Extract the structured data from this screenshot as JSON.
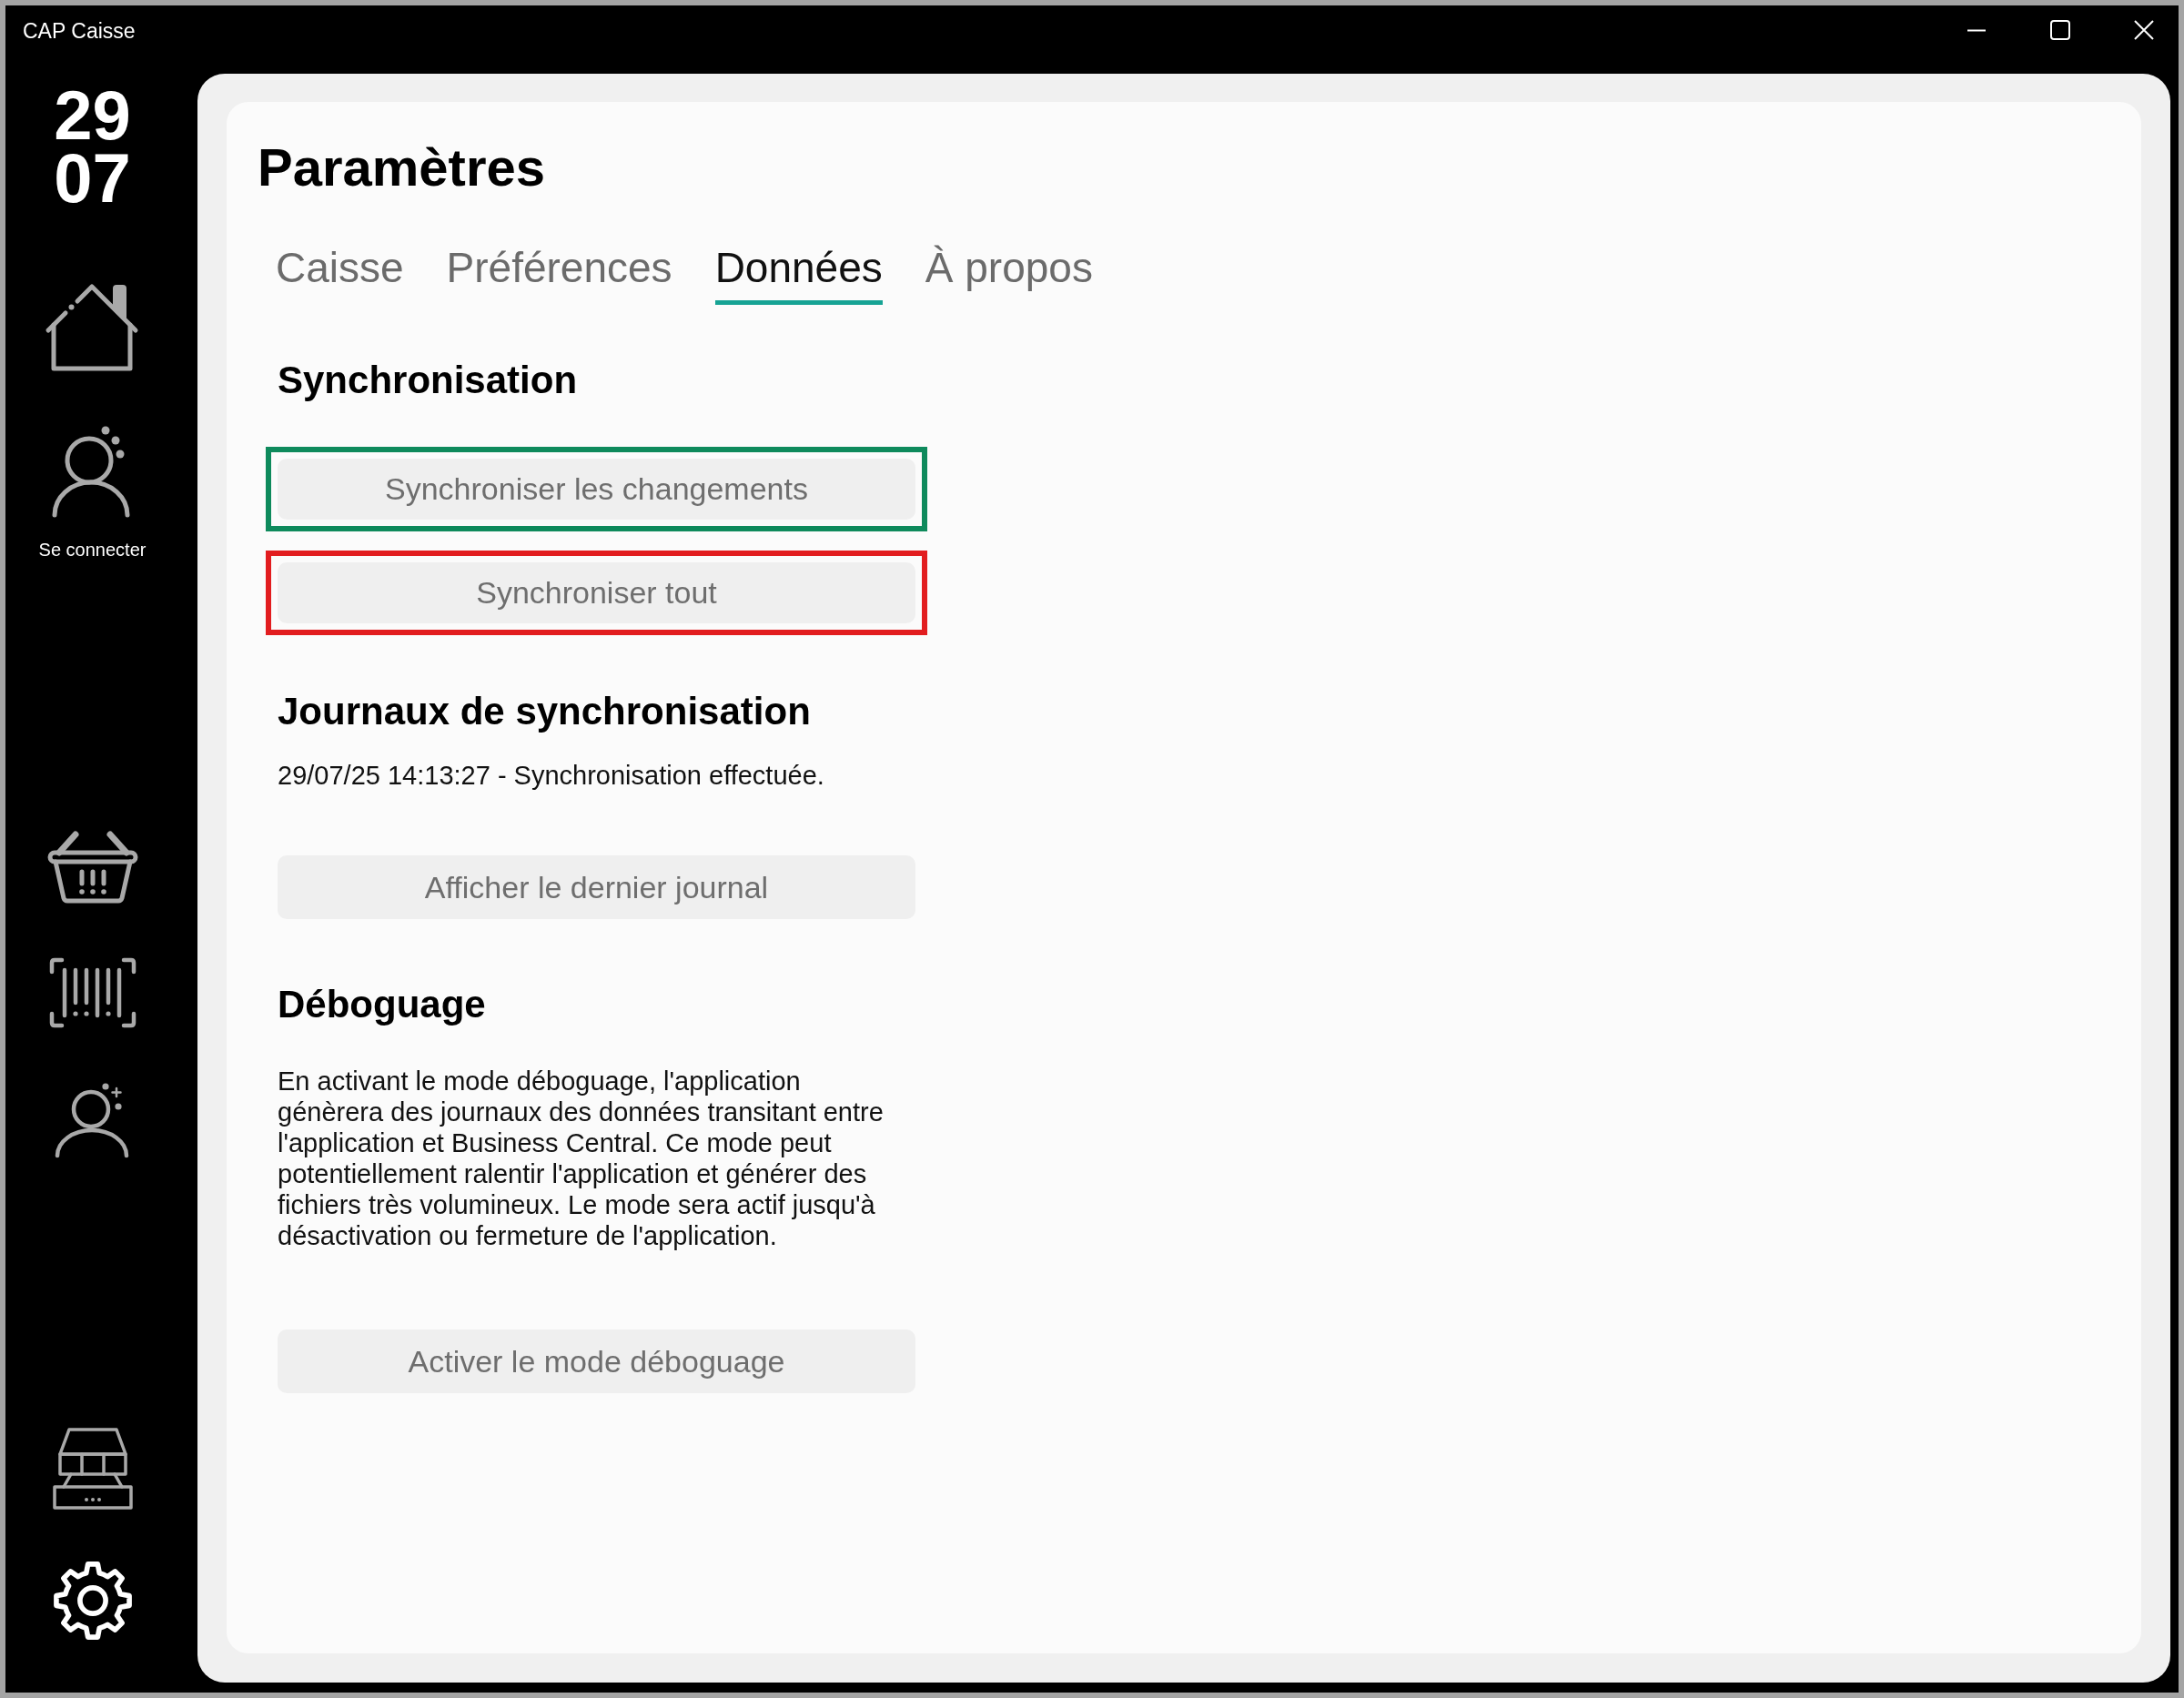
{
  "window": {
    "title": "CAP Caisse"
  },
  "sidebar": {
    "date_day": "29",
    "date_month": "07",
    "top_items": [
      {
        "kind": "home",
        "selected": false
      },
      {
        "kind": "login",
        "label": "Se connecter",
        "selected": false
      }
    ],
    "middle_items": [
      {
        "kind": "basket",
        "selected": false
      },
      {
        "kind": "barcode",
        "selected": false
      },
      {
        "kind": "customer",
        "selected": false
      }
    ],
    "bottom_items": [
      {
        "kind": "register",
        "selected": false
      },
      {
        "kind": "settings",
        "selected": true
      }
    ]
  },
  "page_title": "Paramètres",
  "tabs": [
    {
      "label": "Caisse",
      "selected": false
    },
    {
      "label": "Préférences",
      "selected": false
    },
    {
      "label": "Données",
      "selected": true
    },
    {
      "label": "À propos",
      "selected": false
    }
  ],
  "synchronisation": {
    "heading": "Synchronisation",
    "buttons": [
      {
        "label": "Synchroniser les changements",
        "color": "#0e8a5c"
      },
      {
        "label": "Synchroniser tout",
        "color": "#e21d1f"
      }
    ]
  },
  "sync_logs": {
    "heading": "Journaux de synchronisation",
    "entry": "29/07/25 14:13:27 - Synchronisation effectuée.",
    "button": "Afficher le dernier journal"
  },
  "debugging": {
    "heading": "Déboguage",
    "description_lines": [
      "En activant le mode déboguage, l'application",
      "génèrera des journaux des données transitant entre",
      "l'application et Business Central. Ce mode peut",
      "potentiellement ralentir l'application et générer des",
      "fichiers très volumineux. Le mode sera actif jusqu'à",
      "désactivation ou fermeture de l'application."
    ],
    "button": "Activer le mode déboguage"
  }
}
